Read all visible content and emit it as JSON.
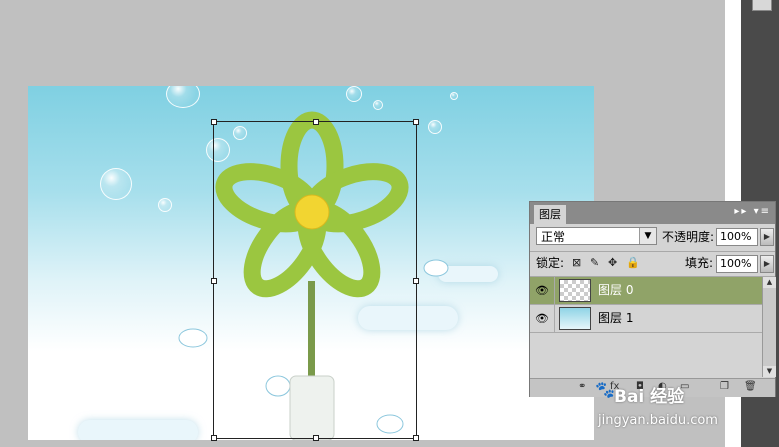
{
  "layers_panel": {
    "tab_label": "图层",
    "blend_mode": "正常",
    "opacity_label": "不透明度:",
    "opacity_value": "100%",
    "lock_label": "锁定:",
    "fill_label": "填充:",
    "fill_value": "100%",
    "layers": [
      {
        "name": "图层 0",
        "selected": true,
        "visible": true,
        "thumbnail": "transparent-checker-with-flower"
      },
      {
        "name": "图层 1",
        "selected": false,
        "visible": true,
        "thumbnail": "sky-background"
      }
    ]
  },
  "canvas": {
    "content": "flower-image-on-sky-background",
    "selection": "free-transform-box"
  },
  "watermark": {
    "text": "Bai 经验",
    "url": "jingyan.baidu.com"
  },
  "icons": {
    "eye": "eye-icon",
    "chevron": "chevron-down-icon",
    "lock": "lock-icon",
    "move": "move-icon",
    "brush": "brush-icon",
    "link": "link-icon",
    "trash": "trash-icon"
  },
  "colors": {
    "selected_layer": "#90a368",
    "panel_bg": "#d4d4d4",
    "workspace_bg": "#c0c0c0",
    "sky_top": "#7fd0e2"
  }
}
